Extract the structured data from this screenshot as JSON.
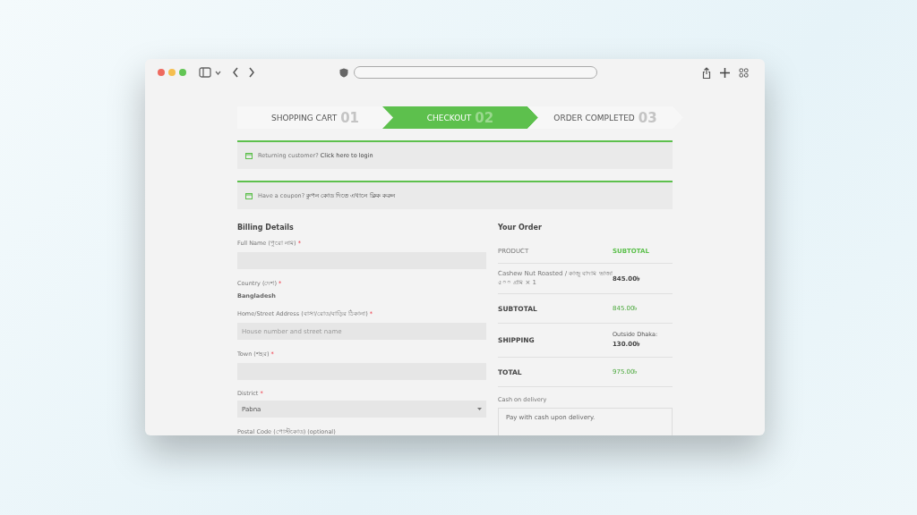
{
  "steps": [
    {
      "label": "SHOPPING CART",
      "number": "01",
      "selected": false
    },
    {
      "label": "CHECKOUT",
      "number": "02",
      "selected": true
    },
    {
      "label": "ORDER COMPLETED",
      "number": "03",
      "selected": false
    }
  ],
  "notices": [
    {
      "text": "Returning customer?",
      "link": "Click here to login"
    },
    {
      "text": "Have a coupon?",
      "link": "কুপন কোড দিতে এখানে ক্লিক করুন"
    }
  ],
  "billing": {
    "title": "Billing Details",
    "fields": [
      {
        "kind": "input",
        "label": "Full Name (পুরো নাম)",
        "mark": "*"
      },
      {
        "kind": "static",
        "label": "Country (দেশ)",
        "mark": "*",
        "value": "Bangladesh"
      },
      {
        "kind": "input",
        "label": "Home/Street Address (বাসা/রোড/বাড়ির ঠিকানা)",
        "mark": "*",
        "placeholder": "House number and street name"
      },
      {
        "kind": "input",
        "label": "Town (শহর)",
        "mark": "*"
      },
      {
        "kind": "select",
        "label": "District",
        "mark": "*",
        "value": "Pabna"
      },
      {
        "kind": "label",
        "label": "Postal Code (পোস্টকোড)  (optional)"
      }
    ]
  },
  "order": {
    "title": "Your Order",
    "columns": [
      "PRODUCT",
      "SUBTOTAL"
    ],
    "rows": [
      {
        "kind": "item",
        "label": "Cashew Nut Roasted / কাজু বাদাম ভাজা ৫০০ গ্রাম  × 1",
        "value": "845.00৳"
      },
      {
        "kind": "total",
        "label": "SUBTOTAL",
        "value": "845.00৳"
      },
      {
        "kind": "shipping",
        "label": "SHIPPING",
        "value": "Outside Dhaka:",
        "amount": "130.00৳"
      },
      {
        "kind": "total",
        "label": "TOTAL",
        "value": "975.00৳"
      }
    ],
    "payment": {
      "label": "Cash on delivery",
      "description": "Pay with cash upon delivery."
    }
  }
}
